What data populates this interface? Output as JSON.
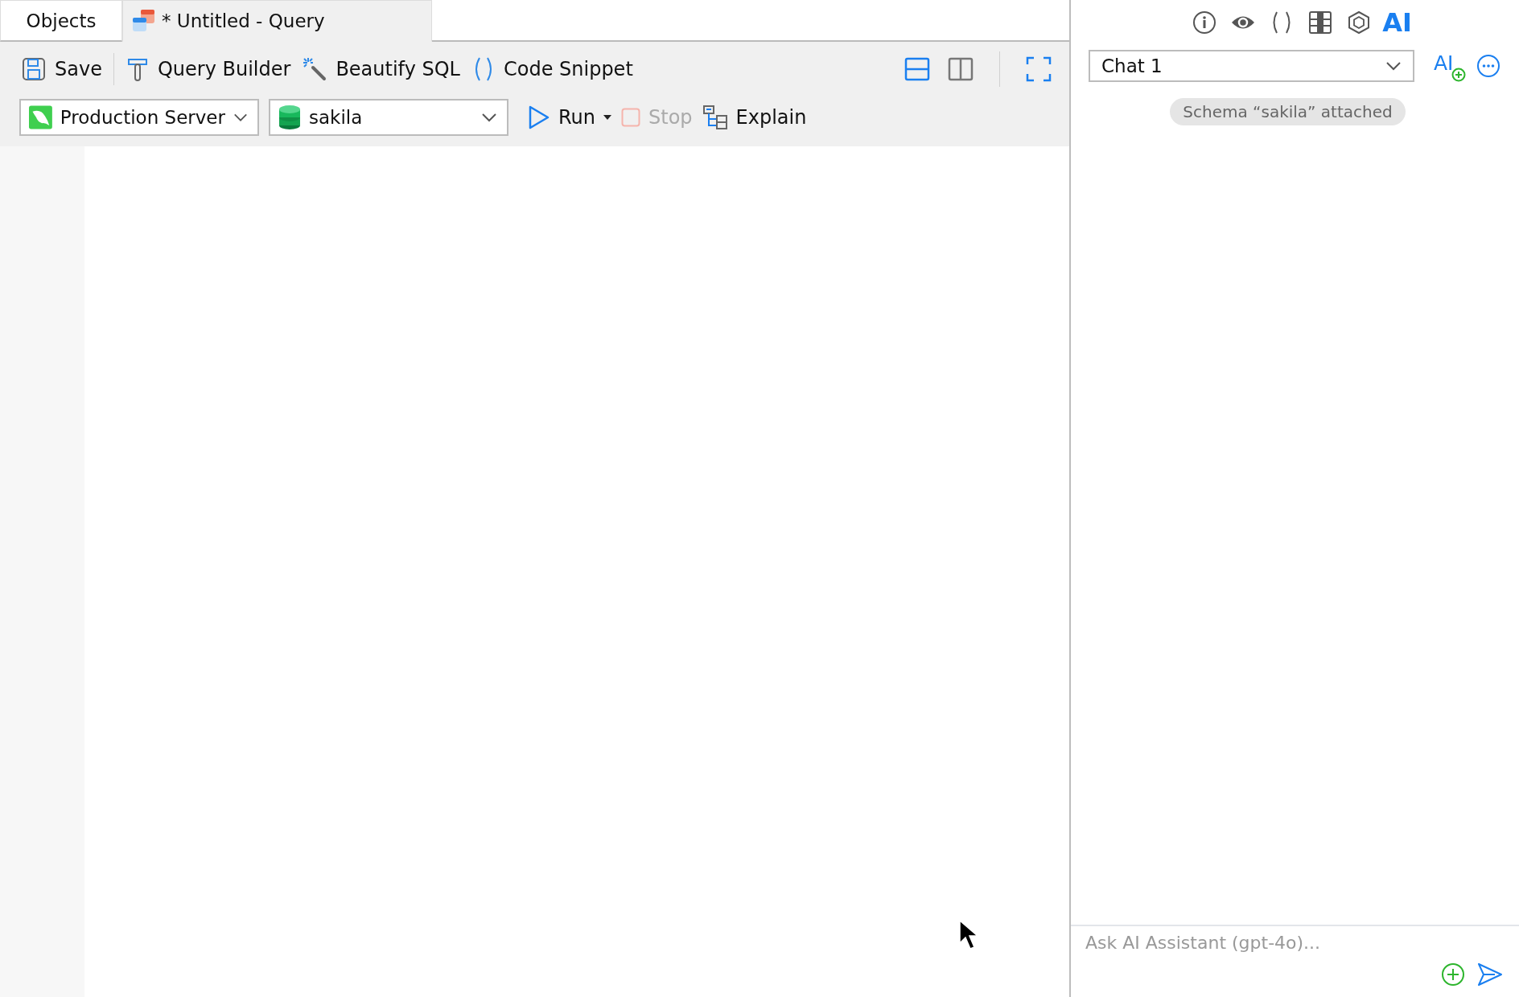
{
  "tabs": [
    {
      "label": "Objects",
      "kind": "plain",
      "selected": false
    },
    {
      "label": "* Untitled - Query",
      "kind": "query",
      "selected": true
    }
  ],
  "toolbar": {
    "save": "Save",
    "query_builder": "Query Builder",
    "beautify": "Beautify SQL",
    "code_snippet": "Code Snippet",
    "layouts": [
      {
        "kind": "stacked",
        "selected": true
      },
      {
        "kind": "side",
        "selected": false
      }
    ],
    "connection": "Production Server",
    "database": "sakila",
    "run": "Run",
    "stop": {
      "label": "Stop",
      "disabled": true
    },
    "explain": "Explain"
  },
  "side_panel": {
    "tabs": [
      {
        "kind": "info",
        "selected": false
      },
      {
        "kind": "eye",
        "selected": false
      },
      {
        "kind": "parens",
        "selected": false
      },
      {
        "kind": "grid",
        "selected": false
      },
      {
        "kind": "hexagon",
        "selected": false
      },
      {
        "kind": "text",
        "label": "AI",
        "selected": true
      }
    ],
    "chat": "Chat 1",
    "new_chat": "AI",
    "notice": "Schema “sakila” attached",
    "input": {
      "placeholder": "Ask AI Assistant (gpt-4o)..."
    }
  }
}
